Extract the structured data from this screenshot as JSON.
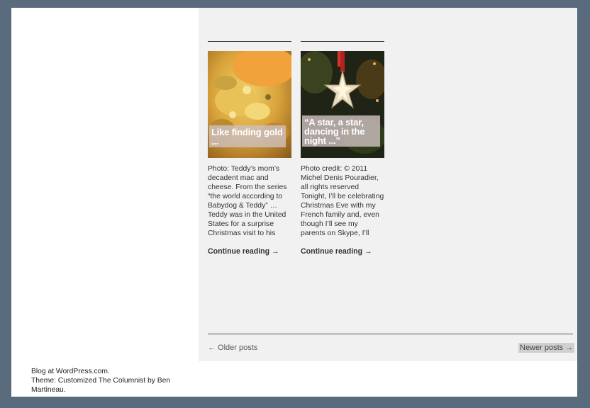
{
  "posts": [
    {
      "caption": "Like finding gold ...",
      "excerpt": "Photo: Teddy’s mom’s decadent mac and cheese. From the series “the world according to Babydog & Teddy” … Teddy was in the United States for a surprise Christmas visit to his",
      "more": "Continue reading →"
    },
    {
      "caption": "“A star, a star, dancing in the night ...”",
      "excerpt": "Photo credit: © 2011 Michel Denis Pouradier, all rights reserved Tonight, I’ll be celebrating Christmas Eve with my French family and, even though I’ll see my parents on Skype, I’ll",
      "more": "Continue reading →"
    }
  ],
  "pagination": {
    "older": "← Older posts",
    "newer": "Newer posts →"
  },
  "footer": {
    "line1": "Blog at WordPress.com.",
    "line2": "Theme: Customized The Columnist by Ben Martineau."
  }
}
